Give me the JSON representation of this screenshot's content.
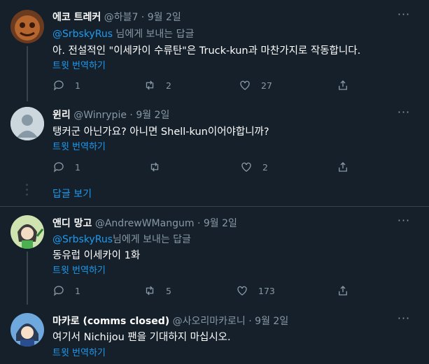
{
  "tweets": [
    {
      "name": "에코 트레커",
      "handle": "@하블7",
      "sep": "·",
      "date": "9월 2일",
      "reply_mention": "@SrbskyRus",
      "reply_suffix": " 님에게 보내는 답글",
      "text": "아. 전설적인 \"이세카이 수류탄\"은 Truck-kun과 마찬가지로 작동합니다.",
      "translate": "트윗 번역하기",
      "replies": "1",
      "retweets": "2",
      "likes": "27"
    },
    {
      "name": "윈리",
      "handle": "@Winrypie",
      "sep": "·",
      "date": "9월 2일",
      "text": "탱커군 아닌가요? 아니면 Shell-kun이어야합니까?",
      "translate": "트윗 번역하기",
      "replies": "1",
      "retweets": "",
      "likes": "2"
    },
    {
      "name": "앤디 망고",
      "handle": "@AndrewWMangum",
      "sep": "·",
      "date": "9월 2일",
      "reply_mention": "@SrbskyRus",
      "reply_suffix": "님에게 보내는 답글",
      "text": "동유럽 이세카이 1화",
      "translate": "트윗 번역하기",
      "replies": "1",
      "retweets": "5",
      "likes": "173"
    },
    {
      "name": "마카로 (comms closed)",
      "handle": "@사오리마카로니",
      "sep": "·",
      "date": "9월 2일",
      "text": "여기서 Nichijou 팬을 기대하지 마십시오.",
      "translate": "트윗 번역하기"
    }
  ],
  "show_replies": "답글 보기",
  "colors": {
    "background": "#15202b",
    "accent": "#1d9bf0",
    "muted": "#8899a6",
    "border": "#38444d"
  }
}
